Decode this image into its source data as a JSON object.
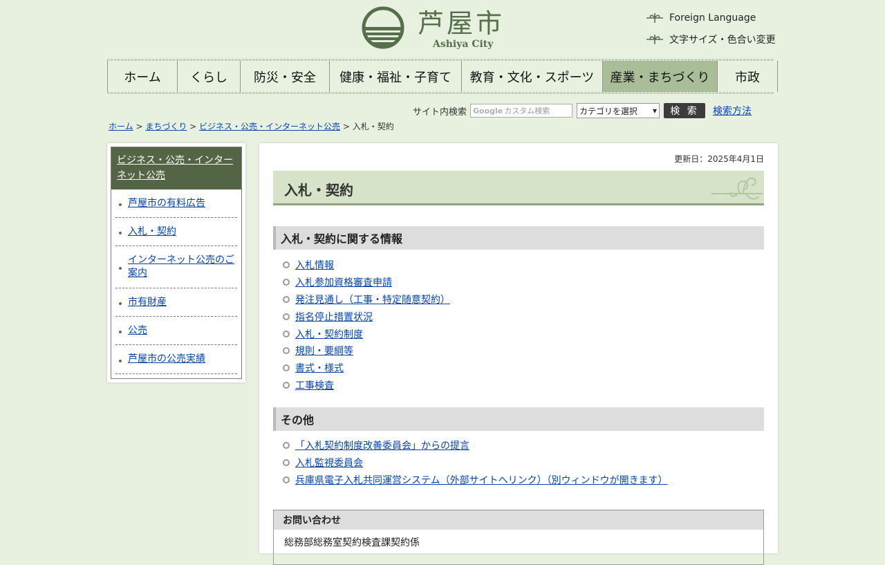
{
  "header": {
    "logo_title": "芦屋市",
    "logo_sub": "Ashiya City",
    "foreign_language": "Foreign Language",
    "font_color": "文字サイズ・色合い変更",
    "brand_color": "#55704a"
  },
  "nav": {
    "items": [
      "ホーム",
      "くらし",
      "防災・安全",
      "健康・福祉・子育て",
      "教育・文化・スポーツ",
      "産業・まちづくり",
      "市政"
    ],
    "active": "産業・まちづくり",
    "active_color": "#a9be98"
  },
  "search": {
    "label": "サイト内検索",
    "google": "Google",
    "placeholder": "カスタム検索",
    "category": "カテゴリを選択",
    "button": "検 索",
    "how": "検索方法"
  },
  "breadcrumb": {
    "items": [
      "ホーム",
      "まちづくり",
      "ビジネス・公売・インターネット公売"
    ],
    "sep": " > ",
    "current": "入札・契約"
  },
  "sidebar": {
    "heading": "ビジネス・公売・インターネット公売",
    "items": [
      "芦屋市の有料広告",
      "入札・契約",
      "インターネット公売のご案内",
      "市有財産",
      "公売",
      "芦屋市の公売実績"
    ]
  },
  "main": {
    "updated": "更新日：2025年4月1日",
    "title": "入札・契約",
    "section1": {
      "heading": "入札・契約に関する情報",
      "links": [
        "入札情報",
        "入札参加資格審査申請",
        "発注見通し（工事・特定随意契約）",
        "指名停止措置状況",
        "入札・契約制度",
        "規則・要綱等",
        "書式・様式",
        "工事検査"
      ]
    },
    "section2": {
      "heading": "その他",
      "links": [
        "「入札契約制度改善委員会」からの提言",
        "入札監視委員会",
        "兵庫県電子入札共同運営システム（外部サイトへリンク）（別ウィンドウが開きます）"
      ]
    },
    "contact": {
      "heading": "お問い合わせ",
      "body": "総務部総務室契約検査課契約係"
    }
  }
}
